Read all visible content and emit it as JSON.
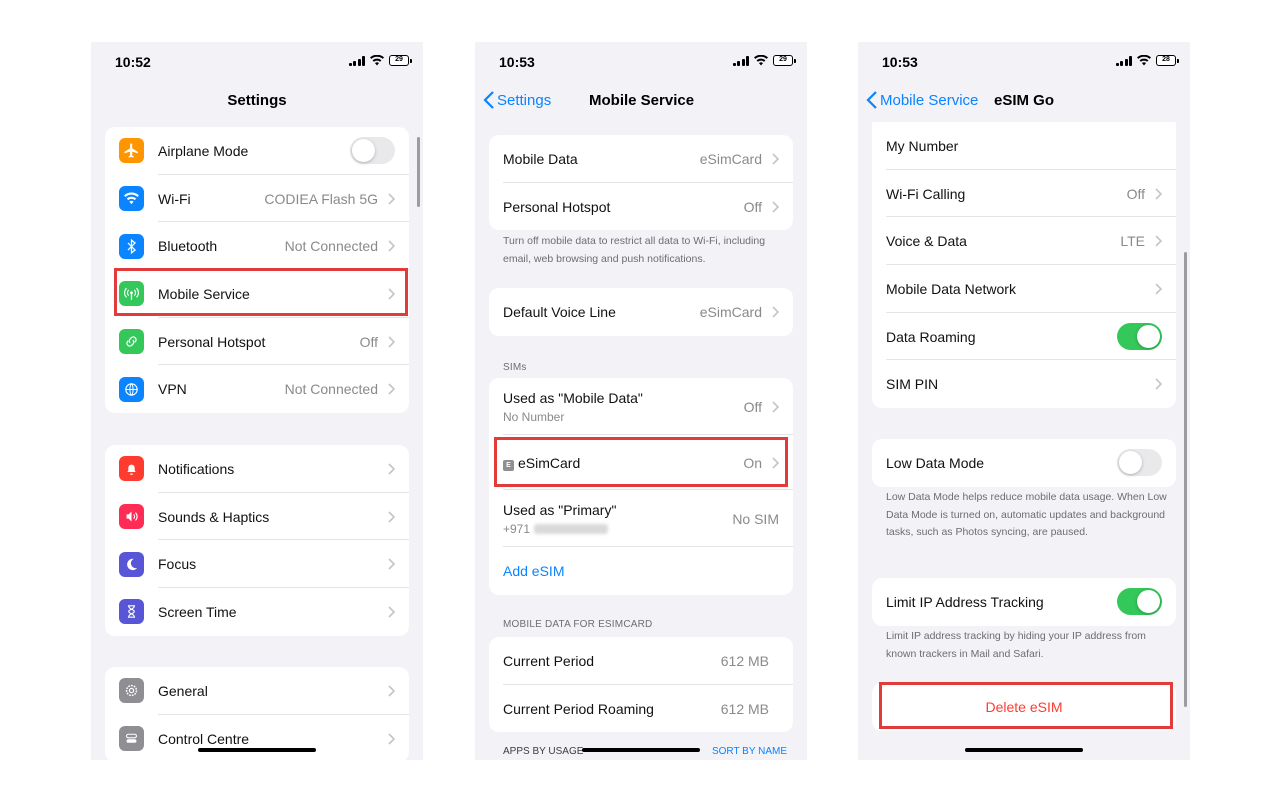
{
  "screens": [
    {
      "time": "10:52",
      "battery": "29",
      "title": "Settings",
      "group1": [
        {
          "label": "Airplane Mode",
          "value": "",
          "icon": "airplane-icon",
          "color": "#ff9500",
          "toggle": "off"
        },
        {
          "label": "Wi-Fi",
          "value": "CODIEA Flash 5G",
          "icon": "wifi-icon",
          "color": "#0a84ff"
        },
        {
          "label": "Bluetooth",
          "value": "Not Connected",
          "icon": "bluetooth-icon",
          "color": "#0a84ff"
        },
        {
          "label": "Mobile Service",
          "value": "",
          "icon": "antenna-icon",
          "color": "#34c759",
          "highlighted": true
        },
        {
          "label": "Personal Hotspot",
          "value": "Off",
          "icon": "link-icon",
          "color": "#34c759"
        },
        {
          "label": "VPN",
          "value": "Not Connected",
          "icon": "globe-icon",
          "color": "#0a84ff"
        }
      ],
      "group2": [
        {
          "label": "Notifications",
          "icon": "bell-icon",
          "color": "#ff3b30"
        },
        {
          "label": "Sounds & Haptics",
          "icon": "speaker-icon",
          "color": "#ff2d55"
        },
        {
          "label": "Focus",
          "icon": "moon-icon",
          "color": "#5856d6"
        },
        {
          "label": "Screen Time",
          "icon": "hourglass-icon",
          "color": "#5856d6"
        }
      ],
      "group3": [
        {
          "label": "General",
          "icon": "gear-icon",
          "color": "#8e8e93"
        },
        {
          "label": "Control Centre",
          "icon": "switches-icon",
          "color": "#8e8e93"
        }
      ]
    },
    {
      "time": "10:53",
      "battery": "29",
      "back": "Settings",
      "title": "Mobile Service",
      "group1": [
        {
          "label": "Mobile Data",
          "value": "eSimCard"
        },
        {
          "label": "Personal Hotspot",
          "value": "Off"
        }
      ],
      "footnote1": "Turn off mobile data to restrict all data to Wi-Fi, including email, web browsing and push notifications.",
      "group2": [
        {
          "label": "Default Voice Line",
          "value": "eSimCard"
        }
      ],
      "sims_header": "SIMs",
      "sims": [
        {
          "label": "Used as \"Mobile Data\"",
          "sub": "No Number",
          "value": "Off"
        },
        {
          "label": "eSimCard",
          "badge": "E",
          "value": "On",
          "highlighted": true
        },
        {
          "label": "Used as \"Primary\"",
          "sub": "+971",
          "value": "No SIM"
        }
      ],
      "add_esim": "Add eSIM",
      "data_header": "MOBILE DATA FOR ESIMCARD",
      "data_rows": [
        {
          "label": "Current Period",
          "value": "612 MB"
        },
        {
          "label": "Current Period Roaming",
          "value": "612 MB"
        }
      ],
      "apps_header": "APPS BY USAGE",
      "sort_label": "SORT BY NAME"
    },
    {
      "time": "10:53",
      "battery": "28",
      "back": "Mobile Service",
      "title": "eSIM Go",
      "group1": [
        {
          "label": "My Number",
          "value": ""
        },
        {
          "label": "Wi-Fi Calling",
          "value": "Off"
        },
        {
          "label": "Voice & Data",
          "value": "LTE"
        },
        {
          "label": "Mobile Data Network",
          "value": ""
        },
        {
          "label": "Data Roaming",
          "toggle": "on"
        },
        {
          "label": "SIM PIN",
          "value": ""
        }
      ],
      "low_data": {
        "label": "Low Data Mode",
        "toggle": "off"
      },
      "footnote_low": "Low Data Mode helps reduce mobile data usage. When Low Data Mode is turned on, automatic updates and background tasks, such as Photos syncing, are paused.",
      "limit_ip": {
        "label": "Limit IP Address Tracking",
        "toggle": "on"
      },
      "footnote_ip": "Limit IP address tracking by hiding your IP address from known trackers in Mail and Safari.",
      "delete": "Delete eSIM"
    }
  ],
  "colors": {
    "accent": "#0a84ff",
    "destructive": "#ff3b30",
    "toggle_on": "#34c759",
    "highlight": "#e23b3b"
  }
}
